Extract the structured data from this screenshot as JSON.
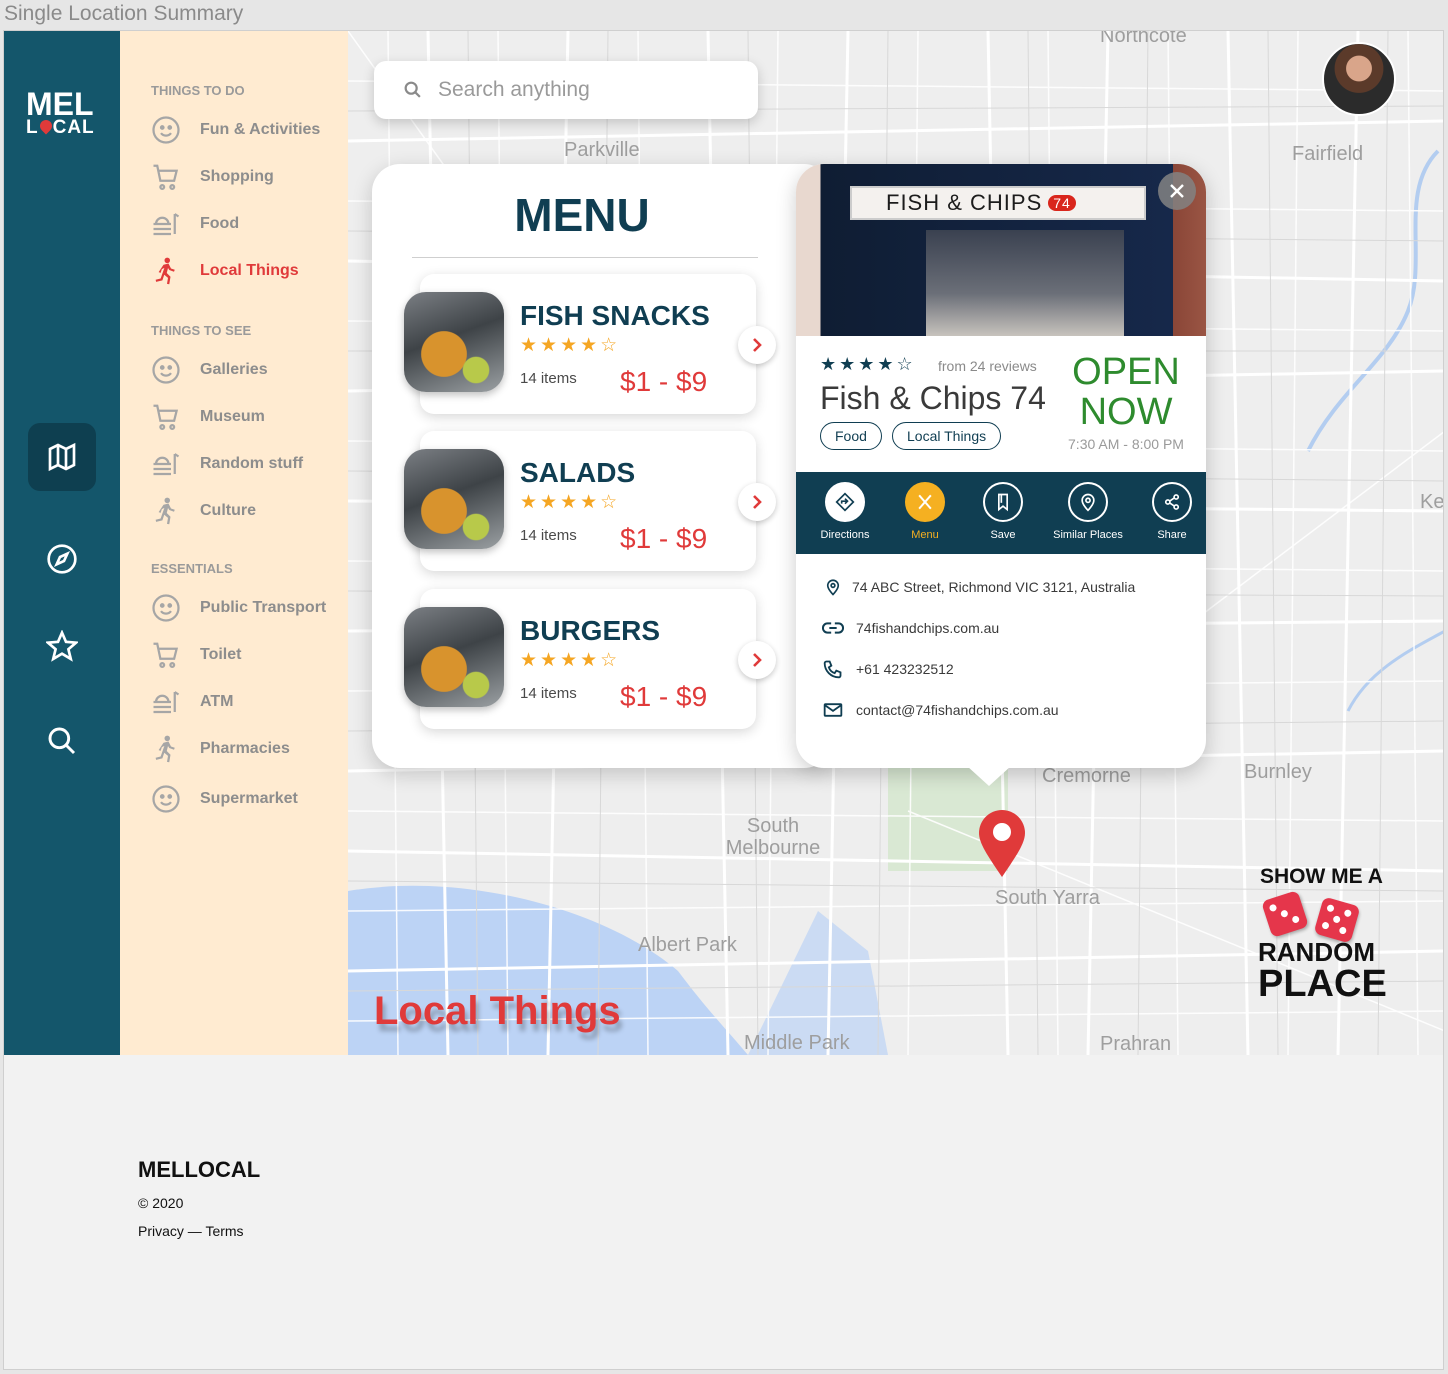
{
  "frame_title": "Single Location Summary",
  "logo": {
    "line1": "MEL",
    "line2_a": "L",
    "line2_b": "CAL"
  },
  "rail": {
    "items": [
      "map-icon",
      "compass-icon",
      "star-icon",
      "search-icon"
    ],
    "active": "map-icon"
  },
  "sidebar": {
    "sections": [
      {
        "heading": "THINGS TO DO",
        "items": [
          {
            "label": "Fun & Activities",
            "icon": "smiley-icon"
          },
          {
            "label": "Shopping",
            "icon": "cart-icon"
          },
          {
            "label": "Food",
            "icon": "food-icon"
          },
          {
            "label": "Local Things",
            "icon": "runner-icon",
            "active": true
          }
        ]
      },
      {
        "heading": "THINGS TO SEE",
        "items": [
          {
            "label": "Galleries",
            "icon": "smiley-icon"
          },
          {
            "label": "Museum",
            "icon": "cart-icon"
          },
          {
            "label": "Random stuff",
            "icon": "food-icon"
          },
          {
            "label": "Culture",
            "icon": "runner-icon"
          }
        ]
      },
      {
        "heading": "ESSENTIALS",
        "items": [
          {
            "label": "Public Transport",
            "icon": "smiley-icon"
          },
          {
            "label": "Toilet",
            "icon": "cart-icon"
          },
          {
            "label": "ATM",
            "icon": "food-icon"
          },
          {
            "label": "Pharmacies",
            "icon": "runner-icon"
          },
          {
            "label": "Supermarket",
            "icon": "smiley-icon"
          }
        ]
      }
    ]
  },
  "search": {
    "placeholder": "Search anything"
  },
  "map_labels": [
    "Northcote",
    "Parkville",
    "Fairfield",
    "Cremorne",
    "Burnley",
    "South Melbourne",
    "South Yarra",
    "Albert Park",
    "Middle Park",
    "Prahran",
    "Kew"
  ],
  "menu": {
    "title": "MENU",
    "items": [
      {
        "name": "FISH SNACKS",
        "rating": 4,
        "count": "14 items",
        "price": "$1 - $9"
      },
      {
        "name": "SALADS",
        "rating": 4,
        "count": "14 items",
        "price": "$1 - $9"
      },
      {
        "name": "BURGERS",
        "rating": 4,
        "count": "14 items",
        "price": "$1 - $9"
      }
    ]
  },
  "place": {
    "sign": "FISH & CHIPS",
    "sign_number": "74",
    "rating": 4,
    "reviews": "from 24 reviews",
    "name": "Fish & Chips 74",
    "status": "OPEN NOW",
    "hours": "7:30 AM - 8:00 PM",
    "tags": [
      "Food",
      "Local Things"
    ],
    "actions": [
      {
        "label": "Directions",
        "icon": "directions-icon"
      },
      {
        "label": "Menu",
        "icon": "cutlery-icon",
        "active": true
      },
      {
        "label": "Save",
        "icon": "bookmark-icon"
      },
      {
        "label": "Similar Places",
        "icon": "pin-icon"
      },
      {
        "label": "Share",
        "icon": "share-icon"
      }
    ],
    "address": "74 ABC Street, Richmond VIC  3121, Australia",
    "website": "74fishandchips.com.au",
    "phone": "+61 423232512",
    "email": "contact@74fishandchips.com.au"
  },
  "category_title": "Local Things",
  "random": {
    "line1": "SHOW ME A",
    "line2": "RANDOM",
    "line3": "PLACE"
  },
  "colors": {
    "primary": "#14566b",
    "dark": "#103e52",
    "accent_red": "#e03a3a",
    "accent_yellow": "#f5b021",
    "sidebar_bg": "#ffebd1",
    "open_green": "#2e8b2e"
  },
  "footer": {
    "brand": "MELLOCAL",
    "copyright": "© 2020",
    "privacy": "Privacy",
    "sep": " — ",
    "terms": "Terms"
  }
}
